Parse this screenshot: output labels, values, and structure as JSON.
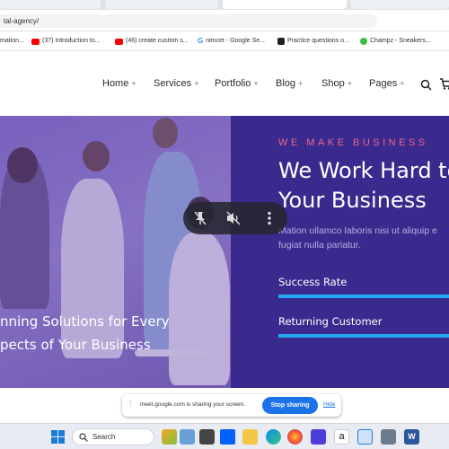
{
  "browser": {
    "tabs": [
      "",
      "",
      "",
      ""
    ],
    "url": "tal-agency/",
    "bookmarks": [
      {
        "label": "mation...",
        "color": "#9aa0a6"
      },
      {
        "label": "(37) Introduction to...",
        "color": "#ff0000"
      },
      {
        "label": "(46) create custom s...",
        "color": "#ff0000"
      },
      {
        "label": "nimcet - Google Se...",
        "color": "#4285f4"
      },
      {
        "label": "Practice questions o...",
        "color": "#222222"
      },
      {
        "label": "Champz - Sneakers...",
        "color": "#3fbf3f"
      }
    ]
  },
  "site": {
    "nav": [
      "Home",
      "Services",
      "Portfolio",
      "Blog",
      "Shop",
      "Pages"
    ],
    "nav_suffix": "+",
    "hero": {
      "eyebrow": "WE MAKE BUSINESS",
      "heading_line1": "We Work Hard to",
      "heading_line2": "Your Business",
      "para_line1": "Mation ullamco laboris nisi ut aliquip e",
      "para_line2": "fugiat nulla pariatur.",
      "left_line1": "nning Solutions for Every",
      "left_line2": "pects of Your Business",
      "skills": [
        {
          "label": "Success Rate",
          "level": 1.0
        },
        {
          "label": "Returning Customer",
          "level": 1.0
        }
      ]
    }
  },
  "share_notice": {
    "text": "meet.google.com is sharing your screen.",
    "stop_label": "Stop sharing",
    "hide_label": "Hide"
  },
  "taskbar": {
    "search_placeholder": "Search"
  },
  "colors": {
    "accent_pink": "#f0638a",
    "hero_purple": "#3b2a8e",
    "skill_blue": "#25a8f2",
    "google_blue": "#1a73e8"
  }
}
